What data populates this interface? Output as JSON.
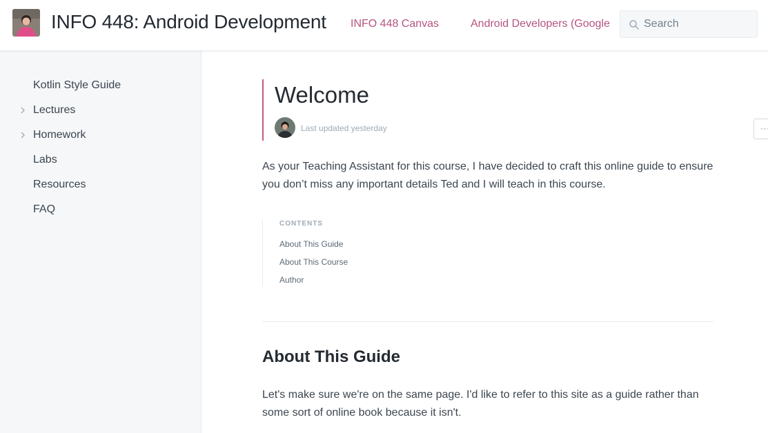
{
  "header": {
    "site_title": "INFO 448: Android Development",
    "nav_links": [
      "INFO 448 Canvas",
      "Android Developers (Google"
    ],
    "search_placeholder": "Search"
  },
  "sidebar": {
    "items": [
      {
        "label": "Kotlin Style Guide",
        "expandable": false
      },
      {
        "label": "Lectures",
        "expandable": true
      },
      {
        "label": "Homework",
        "expandable": true
      },
      {
        "label": "Labs",
        "expandable": false
      },
      {
        "label": "Resources",
        "expandable": false
      },
      {
        "label": "FAQ",
        "expandable": false
      }
    ]
  },
  "page": {
    "title": "Welcome",
    "last_updated": "Last updated yesterday",
    "more_label": "···",
    "intro": "As your Teaching Assistant for this course, I have decided to craft this online guide to ensure you don’t miss any important details Ted and I will teach in this course.",
    "contents": {
      "title": "CONTENTS",
      "items": [
        "About This Guide",
        "About This Course",
        "Author"
      ]
    },
    "section_heading": "About This Guide",
    "section_text": "Let's make sure we're on the same page. I'd like to refer to this site as a guide rather than some sort of online book because it isn't."
  },
  "colors": {
    "accent": "#b5547e",
    "sidebar_bg": "#f5f7f9",
    "title_text": "#242a31"
  },
  "icons": {
    "search": "search-icon",
    "chevron": "chevron-right-icon",
    "more": "more-horizontal-icon"
  }
}
